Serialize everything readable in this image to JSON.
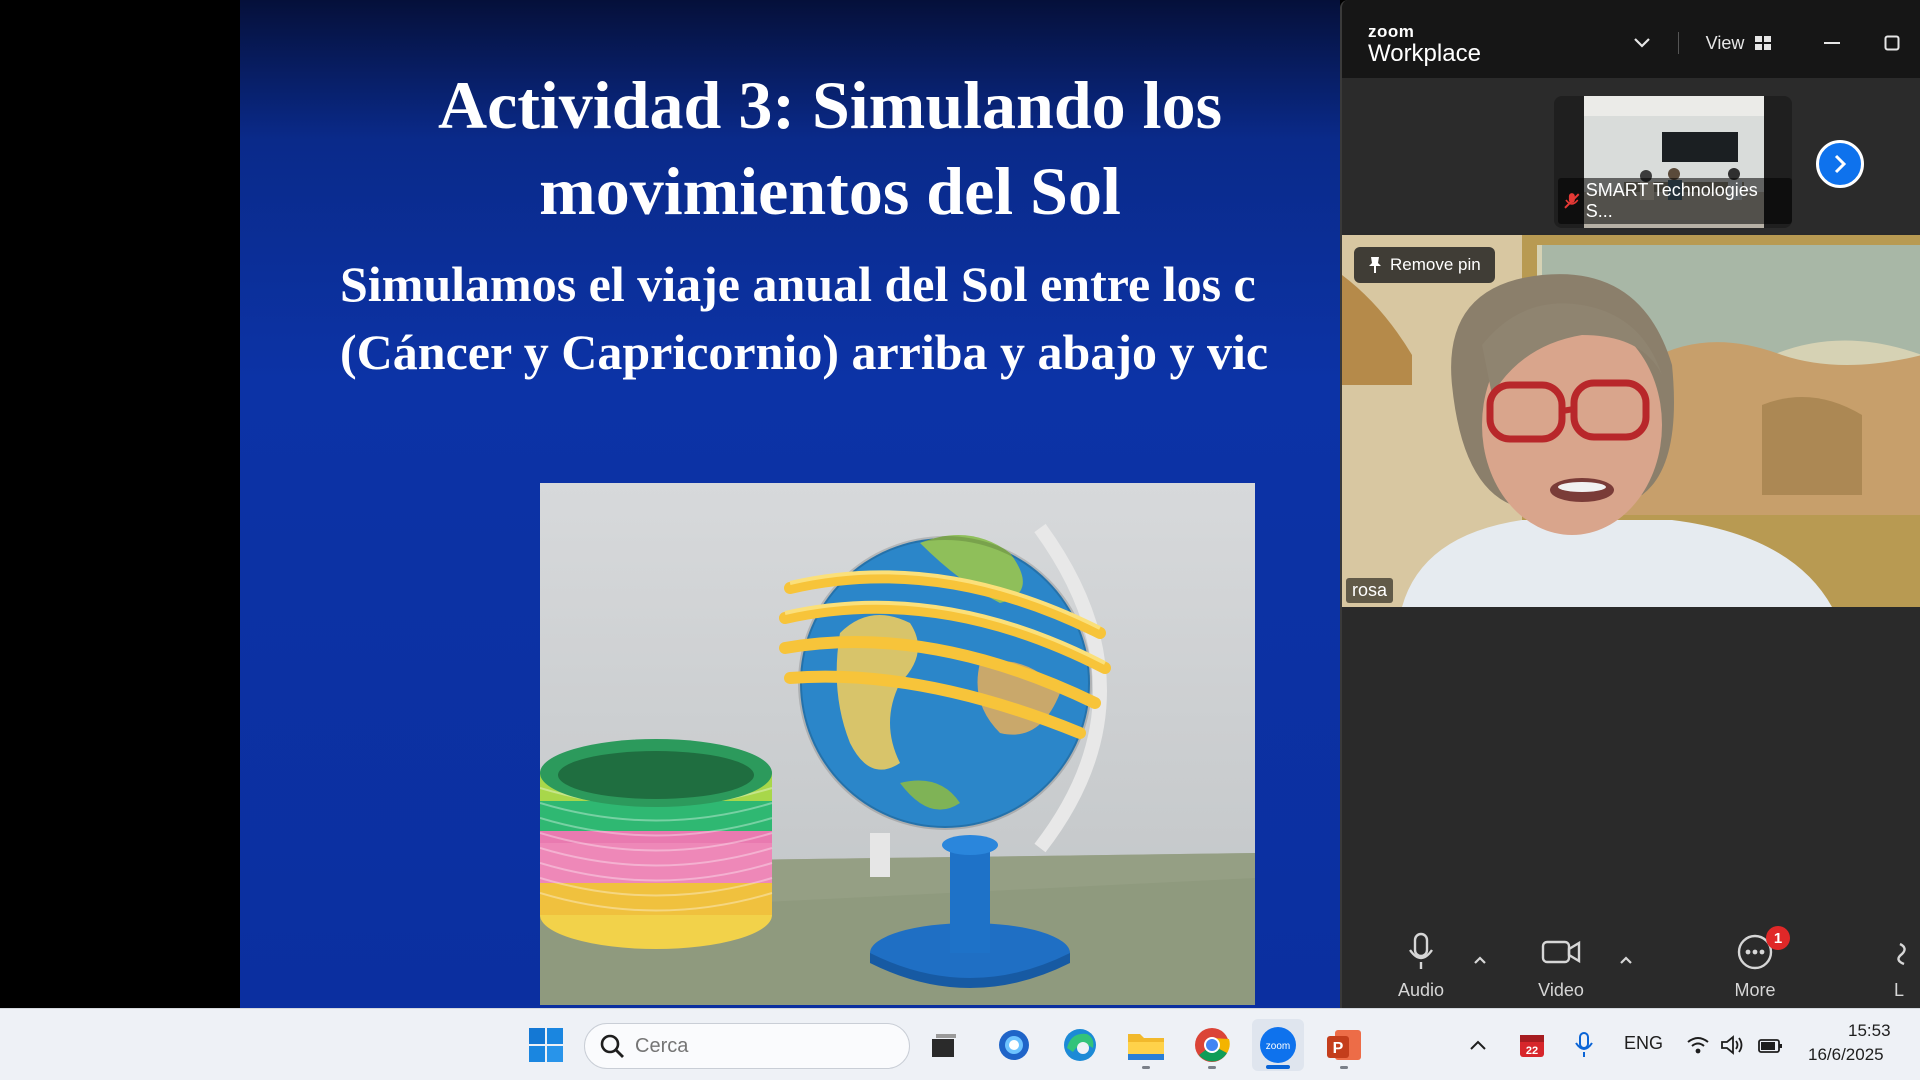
{
  "slide": {
    "title": "Actividad 3: Simulando los\nmovimientos del Sol",
    "body": "Simulamos el viaje anual del Sol entre los c\n(Cáncer y Capricornio) arriba y abajo y vic"
  },
  "zoom": {
    "logo_small": "zoom",
    "logo_big": "Workplace",
    "view_label": "View",
    "thumbnail": {
      "participant_name": "SMART Technologies S...",
      "muted": true
    },
    "speaker": {
      "pin_label": "Remove pin",
      "name": "rosa"
    },
    "toolbar": {
      "audio_label": "Audio",
      "video_label": "Video",
      "more_label": "More",
      "more_badge": "1",
      "cut_label": "L"
    }
  },
  "taskbar": {
    "search_placeholder": "Cerca",
    "calendar_badge": "22",
    "language": "ENG",
    "time": "15:53",
    "date": "16/6/2025",
    "apps": [
      "task-view-icon",
      "copilot-icon",
      "edge-icon",
      "file-explorer-icon",
      "chrome-icon",
      "zoom-icon",
      "powerpoint-icon"
    ]
  },
  "colors": {
    "slide_blue": "#0c33a6",
    "zoom_blue": "#0e72ed",
    "badge_red": "#e02828",
    "taskbar_bg": "#eef1f6"
  }
}
